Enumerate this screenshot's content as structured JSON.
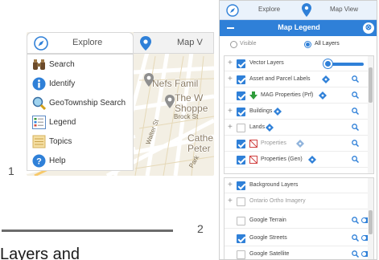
{
  "figure_numbers": {
    "first": "1",
    "second": "2"
  },
  "bottom_text": "Layers and",
  "panel1": {
    "tabs": {
      "explore": "Explore",
      "mapview": "Map V"
    },
    "menu": [
      {
        "label": "Search",
        "icon": "binoculars-icon"
      },
      {
        "label": "Identify",
        "icon": "info-icon"
      },
      {
        "label": "GeoTownship Search",
        "icon": "magnifier-icon"
      },
      {
        "label": "Legend",
        "icon": "legend-icon"
      },
      {
        "label": "Topics",
        "icon": "topics-icon"
      },
      {
        "label": "Help",
        "icon": "help-icon"
      }
    ],
    "map_labels": {
      "nefs": "Nefs Famil",
      "the": "The W",
      "shoppe": "Shoppe",
      "brock": "Brock St",
      "cathe": "Cathe",
      "peter": "Peter",
      "walter": "Walter St",
      "park": "Park"
    }
  },
  "panel2": {
    "tabs": {
      "explore": "Explore",
      "mapview": "Map View"
    },
    "title": "Map Legend",
    "close": "⊗",
    "radio": {
      "visible": "Visible",
      "all": "All Layers",
      "selected": "All Layers"
    },
    "vector_layers": [
      {
        "label": "Vector Layers",
        "checked": true,
        "expand": "+",
        "slider": true
      },
      {
        "label": "Asset and Parcel Labels",
        "checked": true,
        "expand": "+",
        "info": true,
        "search": true
      },
      {
        "label": "MAG Properties (Prf)",
        "checked": true,
        "info": true,
        "search": true,
        "symbol": "green-arrow"
      },
      {
        "label": "Buildings",
        "checked": true,
        "expand": "+",
        "info": true,
        "search": true
      },
      {
        "label": "Lands",
        "checked": false,
        "expand": "+",
        "info": true,
        "search": true
      },
      {
        "label": "Properties",
        "checked": true,
        "info": true,
        "search": true,
        "symbol": "red-box",
        "dim": true
      },
      {
        "label": "Properties (Gen)",
        "checked": true,
        "info": true,
        "search": true,
        "symbol": "red-box"
      }
    ],
    "background_layers": [
      {
        "label": "Background Layers",
        "checked": true,
        "expand": "+"
      },
      {
        "label": "Ontario Ortho Imagery",
        "checked": false,
        "expand": "+",
        "dim": true
      },
      {
        "label": "Google Terrain",
        "checked": false,
        "search": true,
        "toggle": true
      },
      {
        "label": "Google Streets",
        "checked": true,
        "search": true,
        "toggle": true
      },
      {
        "label": "Google Satellite",
        "checked": false,
        "search": true,
        "toggle": true
      }
    ]
  },
  "colors": {
    "accent": "#2f80d8",
    "map_bg": "#f3efe4"
  }
}
